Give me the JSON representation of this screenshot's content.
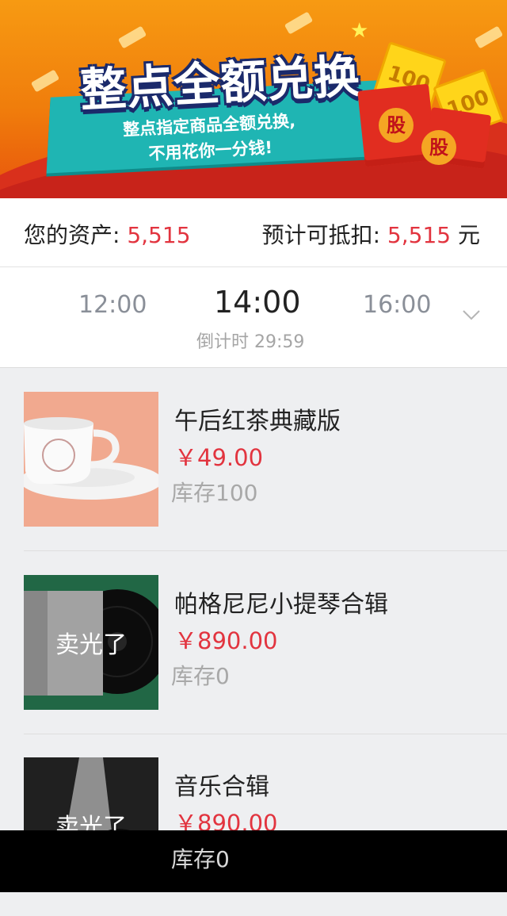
{
  "banner": {
    "headline": "整点全额兑换",
    "subtitle_line1": "整点指定商品全额兑换,",
    "subtitle_line2": "不用花你一分钱!",
    "bill_text_1": "100",
    "bill_text_2": "100",
    "badge_1": "股",
    "badge_2": "股"
  },
  "assets": {
    "label": "您的资产: ",
    "value": "5,515",
    "deduct_label": "预计可抵扣: ",
    "deduct_value": "5,515",
    "deduct_unit": " 元"
  },
  "timebar": {
    "prev": "12:00",
    "current": "14:00",
    "next": "16:00",
    "countdown": "倒计时 29:59",
    "chevron_icon": "chevron-down-icon"
  },
  "products": [
    {
      "name": "午后红茶典藏版",
      "price": "￥49.00",
      "stock": "库存100",
      "soldout": ""
    },
    {
      "name": "帕格尼尼小提琴合辑",
      "price": "￥890.00",
      "stock": "库存0",
      "soldout": "卖光了"
    },
    {
      "name": "音乐合辑",
      "price": "￥890.00",
      "stock": "库存0",
      "soldout": "卖光了"
    }
  ],
  "colors": {
    "accent_red": "#e2343f",
    "banner_orange": "#f07d0c",
    "ribbon_teal": "#1fb5b3"
  }
}
